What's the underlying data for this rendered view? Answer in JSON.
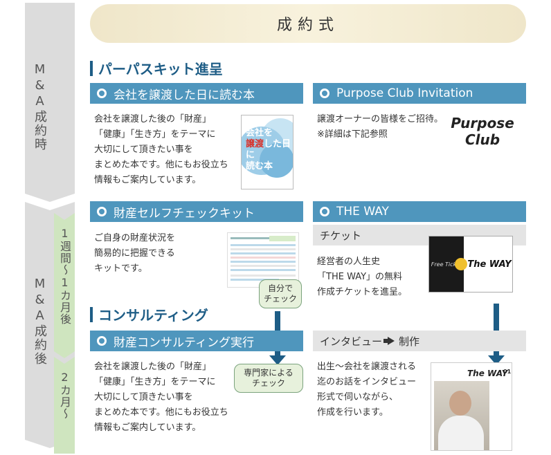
{
  "timeline": {
    "top_label": "M&A成約時",
    "bottom_label": "M&A成約後",
    "period1": "1週間〜1カ月後",
    "period2": "2カ月〜"
  },
  "banner": {
    "title": "成約式"
  },
  "section_gift": {
    "title": "パーパスキット進呈"
  },
  "book_panel": {
    "header": "会社を譲渡した日に読む本",
    "lines": [
      "会社を譲渡した後の「財産」",
      "「健康」「生き方」をテーマに",
      "大切にして頂きたい事を",
      "まとめた本です。他にもお役立ち",
      "情報もご案内しています。"
    ],
    "cover_line1": "会社を",
    "cover_line2_red": "譲渡",
    "cover_line2_rest": "した日に",
    "cover_line3": "読む本"
  },
  "purpose_panel": {
    "header": "Purpose Club Invitation",
    "lines": [
      "譲渡オーナーの皆様をご招待。",
      "※詳細は下記参照"
    ],
    "logo_line1": "Purpose",
    "logo_line2": "Club"
  },
  "selfcheck_panel": {
    "header": "財産セルフチェックキット",
    "lines": [
      "ご自身の財産状況を",
      "簡易的に把握できる",
      "キットです。"
    ],
    "tag": [
      "自分で",
      "チェック"
    ]
  },
  "theway_panel": {
    "header": "THE WAY",
    "sub1": "チケット",
    "lines1": [
      "経営者の人生史",
      "「THE WAY」の無料",
      "作成チケットを進呈。"
    ],
    "ticket_left": "Free Ticket",
    "ticket_right": "The WAY",
    "sub2_a": "インタビュー",
    "sub2_b": "制作",
    "lines2": [
      "出生〜会社を譲渡される",
      "迄のお話をインタビュー",
      "形式で伺いながら、",
      "作成を行います。"
    ],
    "mag_title": "The WAY",
    "mag_num": "01"
  },
  "section_consult": {
    "title": "コンサルティング"
  },
  "consult_panel": {
    "header": "財産コンサルティング実行",
    "lines": [
      "会社を譲渡した後の「財産」",
      "「健康」「生き方」をテーマに",
      "大切にして頂きたい事を",
      "まとめた本です。他にもお役立ち",
      "情報もご案内しています。"
    ],
    "tag": [
      "専門家による",
      "チェック"
    ]
  },
  "colors": {
    "header_blue": "#4f96bd",
    "accent_navy": "#1e5d86",
    "timeline_gray": "#dcdcdc",
    "timeline_green": "#cfe5bf",
    "banner_gold": "#efe6c9"
  }
}
